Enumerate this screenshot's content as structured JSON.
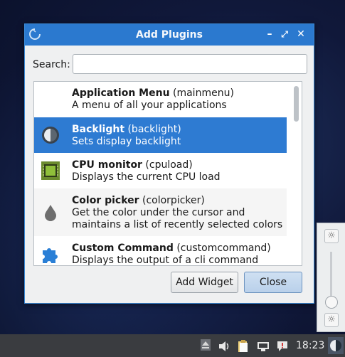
{
  "dialog": {
    "title": "Add Plugins",
    "search_label": "Search:",
    "search_value": "",
    "search_placeholder": "",
    "add_widget_label": "Add Widget",
    "close_label": "Close",
    "accent_color": "#2b79cf"
  },
  "plugins": [
    {
      "name": "Application Menu",
      "id": "(mainmenu)",
      "desc": [
        "A menu of all your applications"
      ],
      "icon": "menu-icon"
    },
    {
      "name": "Backlight",
      "id": "(backlight)",
      "desc": [
        "Sets display backlight"
      ],
      "icon": "brightness-icon",
      "selected": true
    },
    {
      "name": "CPU monitor",
      "id": "(cpuload)",
      "desc": [
        "Displays the current CPU load"
      ],
      "icon": "cpu-chip-icon"
    },
    {
      "name": "Color picker",
      "id": "(colorpicker)",
      "desc": [
        "Get the color under the cursor and",
        "maintains a list of recently selected colors"
      ],
      "icon": "color-drop-icon"
    },
    {
      "name": "Custom Command",
      "id": "(customcommand)",
      "desc": [
        "Displays the output of a cli command"
      ],
      "icon": "puzzle-piece-icon"
    }
  ],
  "brightness_popup": {
    "icon_top": "sun-icon",
    "icon_bottom": "sun-icon"
  },
  "panel": {
    "clock": "18:23"
  }
}
